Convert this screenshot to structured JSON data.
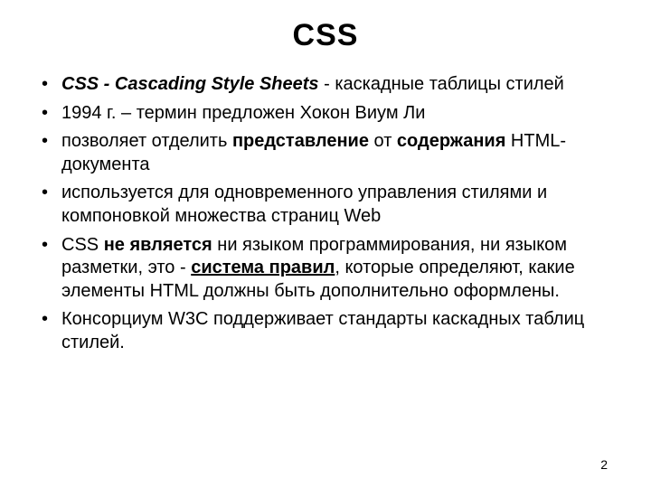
{
  "title": "CSS",
  "bullets": {
    "b1": {
      "s1": "CSS - Cascading Style Sheets",
      "s2": " - каскадные таблицы стилей"
    },
    "b2": {
      "s1": "1994 г. – термин предложен Хокон Виум Ли"
    },
    "b3": {
      "s1": "позволяет отделить ",
      "s2": "представление",
      "s3": " от ",
      "s4": "содержания",
      "s5": " HTML-документа"
    },
    "b4": {
      "s1": "используется для одновременного управления стилями и компоновкой множества страниц Web"
    },
    "b5": {
      "s1": "CSS ",
      "s2": "не является",
      "s3": " ни языком программирования, ни языком разметки, это - ",
      "s4": "система правил",
      "s5": ", которые определяют, какие элементы HTML должны быть дополнительно оформлены."
    },
    "b6": {
      "s1": "Консорциум W3C поддерживает стандарты каскадных таблиц стилей."
    }
  },
  "page_number": "2"
}
